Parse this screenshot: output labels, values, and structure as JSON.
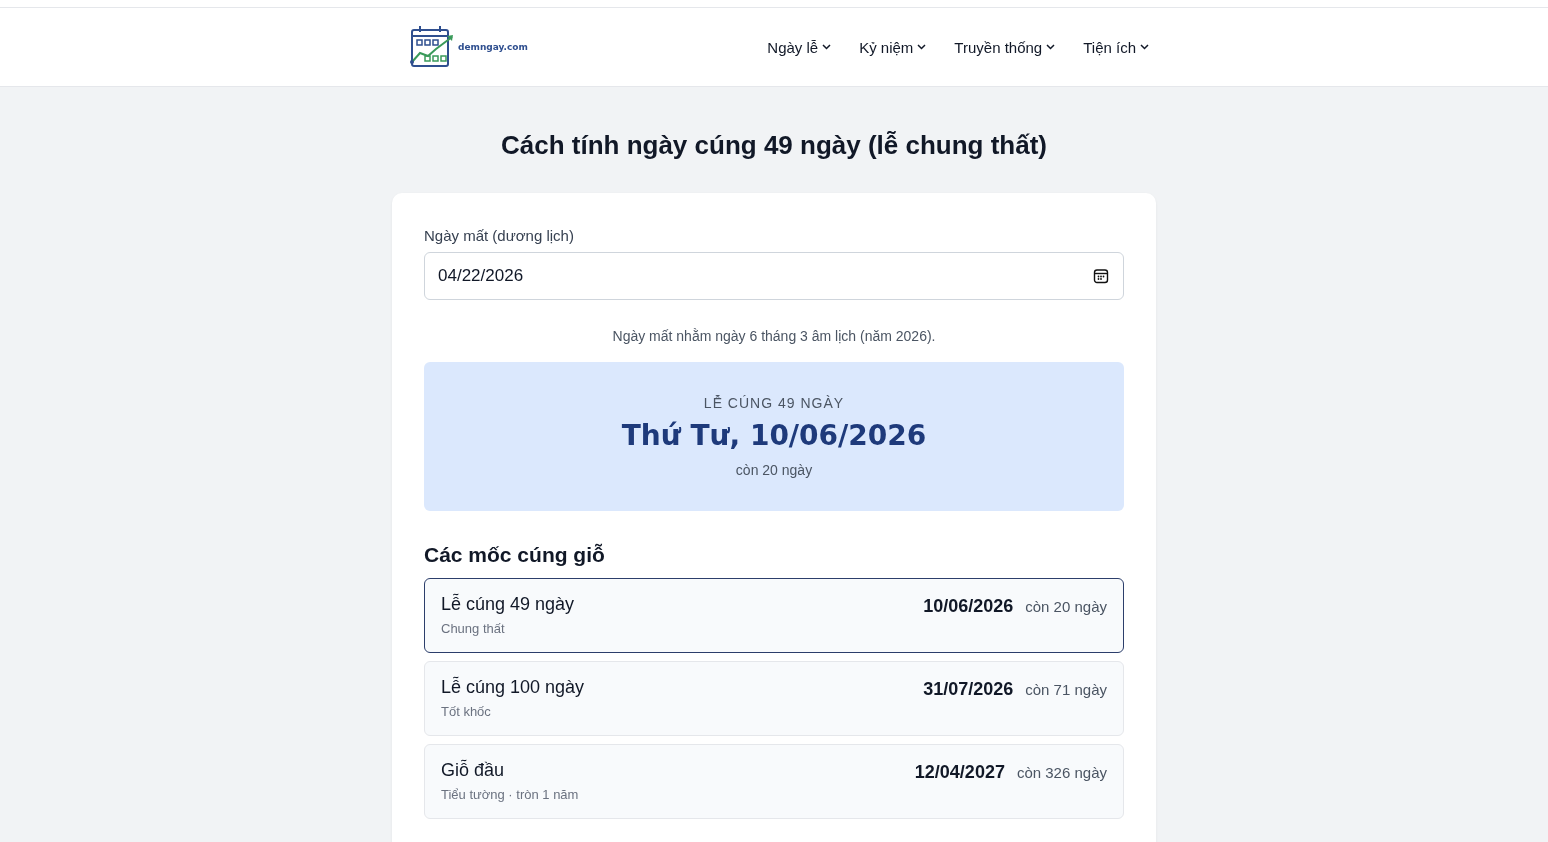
{
  "header": {
    "logo_text": "demngay.com",
    "nav": [
      {
        "label": "Ngày lễ"
      },
      {
        "label": "Kỷ niệm"
      },
      {
        "label": "Truyền thống"
      },
      {
        "label": "Tiện ích"
      }
    ]
  },
  "page_title": "Cách tính ngày cúng 49 ngày (lễ chung thất)",
  "form": {
    "label": "Ngày mất (dương lịch)",
    "value": "04/22/2026"
  },
  "lunar_note": "Ngày mất nhằm ngày 6 tháng 3 âm lịch (năm 2026).",
  "highlight": {
    "eyebrow": "LỄ CÚNG 49 NGÀY",
    "date": "Thứ Tư, 10/06/2026",
    "remaining": "còn 20 ngày"
  },
  "milestones_title": "Các mốc cúng giỗ",
  "milestones": [
    {
      "name": "Lễ cúng 49 ngày",
      "subtitle": "Chung thất",
      "date": "10/06/2026",
      "remaining": "còn 20 ngày",
      "selected": true
    },
    {
      "name": "Lễ cúng 100 ngày",
      "subtitle": "Tốt khốc",
      "date": "31/07/2026",
      "remaining": "còn 71 ngày",
      "selected": false
    },
    {
      "name": "Giỗ đầu",
      "subtitle": "Tiểu tường · tròn 1 năm",
      "date": "12/04/2027",
      "remaining": "còn 326 ngày",
      "selected": false
    }
  ]
}
